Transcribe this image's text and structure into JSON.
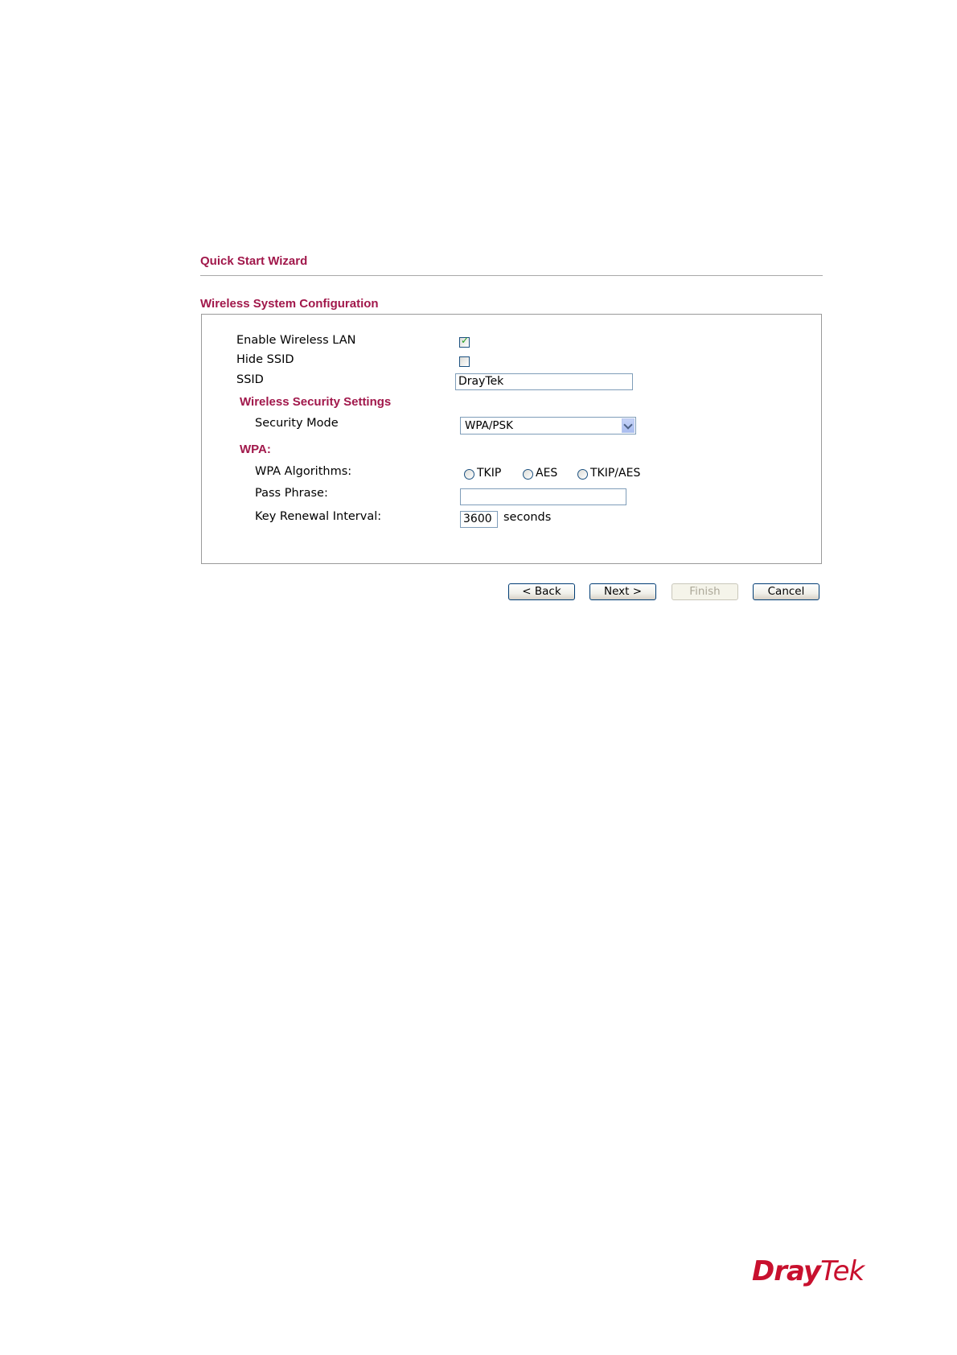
{
  "wizard": {
    "title": "Quick Start Wizard",
    "section_title": "Wireless System Configuration"
  },
  "fields": {
    "enable_wireless_lan": {
      "label": "Enable Wireless LAN",
      "checked": true
    },
    "hide_ssid": {
      "label": "Hide SSID",
      "checked": false
    },
    "ssid": {
      "label": "SSID",
      "value": "DrayTek"
    }
  },
  "security": {
    "heading": "Wireless Security Settings",
    "mode_label": "Security Mode",
    "mode_value": "WPA/PSK"
  },
  "wpa": {
    "heading": "WPA:",
    "algorithms_label": "WPA Algorithms:",
    "algorithms": [
      "TKIP",
      "AES",
      "TKIP/AES"
    ],
    "pass_phrase_label": "Pass Phrase:",
    "pass_phrase_value": "",
    "key_renewal_label": "Key Renewal Interval:",
    "key_renewal_value": "3600",
    "key_renewal_unit": "seconds"
  },
  "buttons": {
    "back": "< Back",
    "next": "Next >",
    "finish": "Finish",
    "cancel": "Cancel"
  },
  "logo": {
    "part1": "Dray",
    "part2": "Tek",
    "color": "#c8102e"
  },
  "colors": {
    "heading": "#a1184b"
  }
}
